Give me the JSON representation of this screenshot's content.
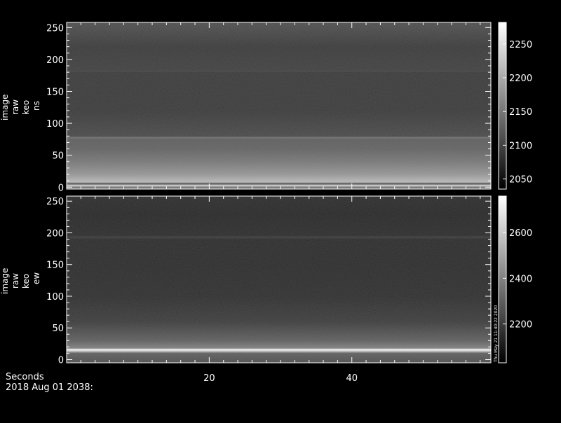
{
  "chart_data": [
    {
      "type": "heatmap",
      "ylabel_lines": [
        "image",
        "raw",
        "keo",
        "ns"
      ],
      "yticks": [
        0,
        50,
        100,
        150,
        200,
        250
      ],
      "ylim": [
        -3,
        258
      ],
      "xlim": [
        0,
        59.5
      ],
      "xticks": [
        20,
        40
      ],
      "colorbar": {
        "ticks": [
          2050,
          2100,
          2150,
          2200,
          2250
        ],
        "range": [
          2035,
          2282
        ]
      },
      "value_profile": {
        "rows": [
          0,
          3,
          5,
          8,
          20,
          40,
          60,
          76,
          77,
          80,
          120,
          150,
          180,
          181,
          184,
          220,
          256
        ],
        "values": [
          2150,
          2250,
          2100,
          2215,
          2180,
          2150,
          2130,
          2125,
          2150,
          2105,
          2090,
          2090,
          2090,
          2100,
          2095,
          2090,
          2110
        ]
      },
      "grid": false
    },
    {
      "type": "heatmap",
      "ylabel_lines": [
        "image",
        "raw",
        "keo",
        "ew"
      ],
      "yticks": [
        0,
        50,
        100,
        150,
        200,
        250
      ],
      "ylim": [
        -5,
        258
      ],
      "xlim": [
        0,
        59.5
      ],
      "xticks": [
        20,
        40
      ],
      "colorbar": {
        "ticks": [
          2200,
          2400,
          2600
        ],
        "range": [
          2030,
          2760
        ]
      },
      "value_profile": {
        "rows": [
          -5,
          10,
          14,
          16,
          18,
          30,
          60,
          100,
          150,
          190,
          193,
          196,
          230,
          256
        ],
        "values": [
          2250,
          2300,
          2650,
          2750,
          2400,
          2300,
          2200,
          2160,
          2150,
          2150,
          2200,
          2150,
          2140,
          2150
        ]
      },
      "grid": false
    }
  ],
  "xaxis": {
    "label": "Seconds"
  },
  "footer": {
    "date": "2018 Aug 01 2038:"
  },
  "stamp": "Thu May 21 11:40:22 2020"
}
